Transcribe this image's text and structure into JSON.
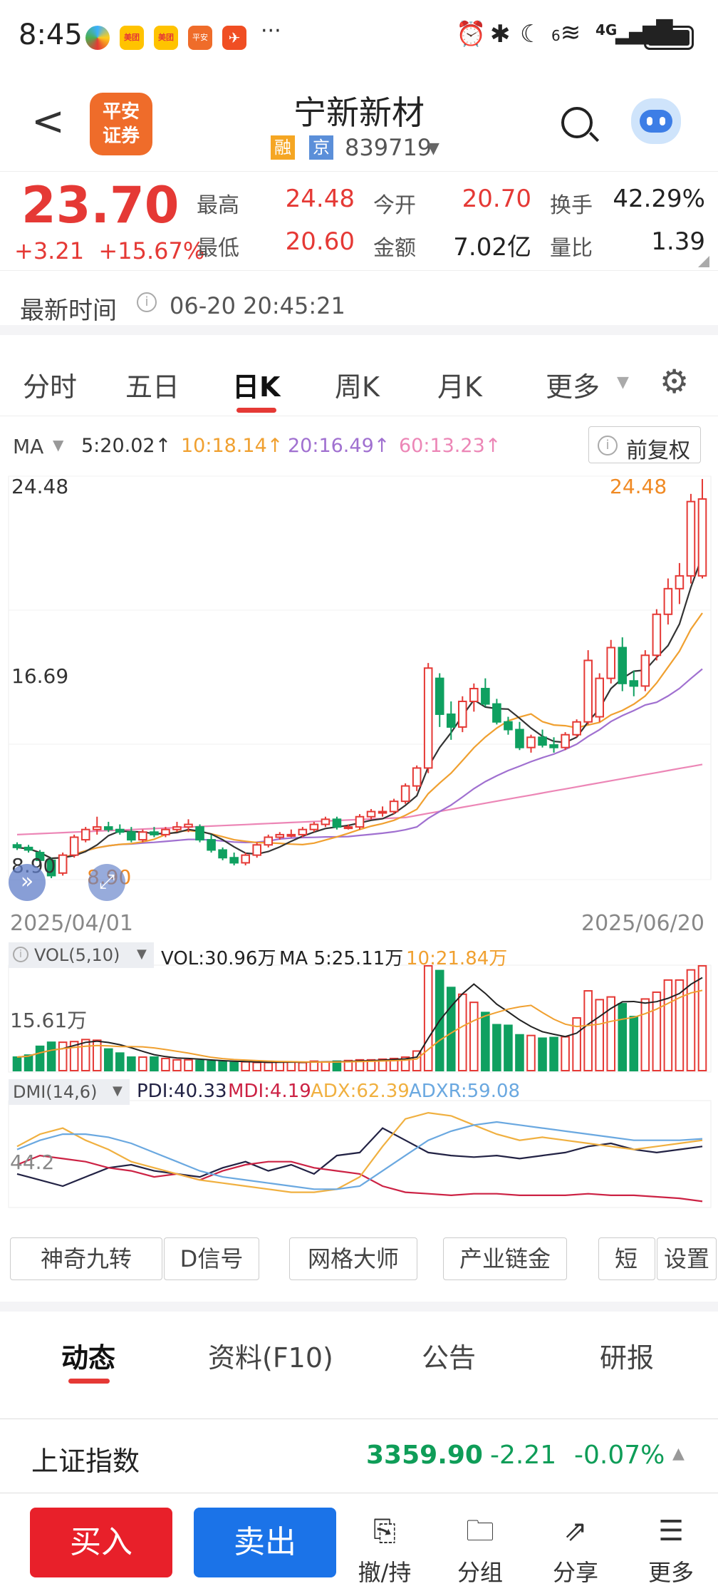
{
  "status_bar": {
    "time": "8:45",
    "network": "4G",
    "signal_superscript": "6"
  },
  "header": {
    "back": "<",
    "broker_logo_lines": [
      "平安",
      "证券"
    ],
    "stock_name": "宁新新材",
    "tag_margin": "融",
    "tag_market": "京",
    "stock_code": "839719"
  },
  "quote": {
    "price": "23.70",
    "change": "+3.21",
    "change_pct": "+15.67%",
    "high_label": "最高",
    "high": "24.48",
    "low_label": "最低",
    "low": "20.60",
    "open_label": "今开",
    "open": "20.70",
    "amount_label": "金额",
    "amount": "7.02亿",
    "turnover_label": "换手",
    "turnover": "42.29%",
    "volume_ratio_label": "量比",
    "volume_ratio": "1.39"
  },
  "update": {
    "label": "最新时间",
    "value": "06-20 20:45:21"
  },
  "chart_tabs": [
    "分时",
    "五日",
    "日K",
    "周K",
    "月K",
    "更多"
  ],
  "chart_tab_active": "日K",
  "ma_line": {
    "label": "MA",
    "ma5": "5:20.02↑",
    "ma10": "10:18.14↑",
    "ma20": "20:16.49↑",
    "ma60": "60:13.23↑",
    "adjust_btn": "前复权",
    "colors": {
      "ma5": "#333333",
      "ma10": "#f0a030",
      "ma20": "#a070d0",
      "ma60": "#ec86b6",
      "up": "#e53935",
      "down": "#0fa060"
    }
  },
  "kline": {
    "y_labels": [
      "24.48",
      "16.69",
      "8.90"
    ],
    "max_label": "24.48",
    "min_label": "8.90",
    "date_start": "2025/04/01",
    "date_end": "2025/06/20"
  },
  "volume": {
    "label": "VOL(5,10)",
    "vol": "VOL:30.96万",
    "ma5": "MA 5:25.11万",
    "ma10": "10:21.84万",
    "y_label": "15.61万"
  },
  "dmi": {
    "label": "DMI(14,6)",
    "pdi": "PDI:40.33",
    "mdi": "MDI:4.19",
    "adx": "ADX:62.39",
    "adxr": "ADXR:59.08",
    "y_label": "44.2",
    "colors": {
      "pdi": "#222244",
      "mdi": "#cc2244",
      "adx": "#f0b040",
      "adxr": "#6aa8e0"
    }
  },
  "feature_buttons": [
    "神奇九转",
    "D信号",
    "网格大师",
    "产业链金",
    "短线",
    "设置"
  ],
  "info_tabs": [
    "动态",
    "资料(F10)",
    "公告",
    "研报"
  ],
  "info_tab_active": "动态",
  "index": {
    "name": "上证指数",
    "value": "3359.90",
    "change": "-2.21",
    "change_pct": "-0.07%"
  },
  "bottom": {
    "buy": "买入",
    "sell": "卖出",
    "icons": [
      {
        "icon": "cancel-hold-icon",
        "label": "撤/持"
      },
      {
        "icon": "group-icon",
        "label": "分组"
      },
      {
        "icon": "share-icon",
        "label": "分享"
      },
      {
        "icon": "more-icon",
        "label": "更多"
      }
    ]
  },
  "chart_data": {
    "type": "candlestick",
    "title": "",
    "x_range": [
      "2025/04/01",
      "2025/06/20"
    ],
    "ylim": [
      8.9,
      24.48
    ],
    "candles_ohlc": [
      [
        10.2,
        10.3,
        10.0,
        10.1
      ],
      [
        10.1,
        10.2,
        9.9,
        10.0
      ],
      [
        9.9,
        10.0,
        9.5,
        9.6
      ],
      [
        9.6,
        9.7,
        8.9,
        9.0
      ],
      [
        9.1,
        9.9,
        9.0,
        9.8
      ],
      [
        9.8,
        10.6,
        9.7,
        10.5
      ],
      [
        10.4,
        10.9,
        10.3,
        10.8
      ],
      [
        10.8,
        11.3,
        10.6,
        10.9
      ],
      [
        10.9,
        11.1,
        10.7,
        10.8
      ],
      [
        10.8,
        11.0,
        10.6,
        10.7
      ],
      [
        10.7,
        10.9,
        10.3,
        10.4
      ],
      [
        10.4,
        10.8,
        10.3,
        10.7
      ],
      [
        10.7,
        10.9,
        10.5,
        10.6
      ],
      [
        10.6,
        10.9,
        10.5,
        10.8
      ],
      [
        10.8,
        11.1,
        10.7,
        10.9
      ],
      [
        10.9,
        11.2,
        10.7,
        11.0
      ],
      [
        10.9,
        11.0,
        10.3,
        10.4
      ],
      [
        10.4,
        10.6,
        9.9,
        10.0
      ],
      [
        10.0,
        10.1,
        9.6,
        9.7
      ],
      [
        9.7,
        9.9,
        9.4,
        9.5
      ],
      [
        9.5,
        9.9,
        9.4,
        9.8
      ],
      [
        9.8,
        10.3,
        9.7,
        10.2
      ],
      [
        10.2,
        10.6,
        10.1,
        10.5
      ],
      [
        10.5,
        10.7,
        10.4,
        10.6
      ],
      [
        10.6,
        10.8,
        10.5,
        10.6
      ],
      [
        10.6,
        10.9,
        10.5,
        10.8
      ],
      [
        10.8,
        11.1,
        10.7,
        11.0
      ],
      [
        11.0,
        11.3,
        10.9,
        11.2
      ],
      [
        11.2,
        11.3,
        10.8,
        10.9
      ],
      [
        10.9,
        11.0,
        10.8,
        10.9
      ],
      [
        10.9,
        11.4,
        10.8,
        11.3
      ],
      [
        11.3,
        11.6,
        11.2,
        11.5
      ],
      [
        11.5,
        11.7,
        11.3,
        11.5
      ],
      [
        11.5,
        12.0,
        11.4,
        11.9
      ],
      [
        11.9,
        12.6,
        11.8,
        12.5
      ],
      [
        12.5,
        13.3,
        12.3,
        13.2
      ],
      [
        13.2,
        17.3,
        13.0,
        17.1
      ],
      [
        16.7,
        16.9,
        14.8,
        15.3
      ],
      [
        15.3,
        15.8,
        14.3,
        14.8
      ],
      [
        14.8,
        16.0,
        14.6,
        15.8
      ],
      [
        15.8,
        16.5,
        15.4,
        16.3
      ],
      [
        16.3,
        16.7,
        15.6,
        15.7
      ],
      [
        15.7,
        15.9,
        14.9,
        15.0
      ],
      [
        15.0,
        15.2,
        14.5,
        14.7
      ],
      [
        14.7,
        15.0,
        13.9,
        14.0
      ],
      [
        14.0,
        14.5,
        13.8,
        14.4
      ],
      [
        14.4,
        14.7,
        14.0,
        14.1
      ],
      [
        14.1,
        14.4,
        13.8,
        14.0
      ],
      [
        14.0,
        14.6,
        13.9,
        14.5
      ],
      [
        14.5,
        15.1,
        14.4,
        15.0
      ],
      [
        15.0,
        17.8,
        14.9,
        17.4
      ],
      [
        15.2,
        16.9,
        15.0,
        16.7
      ],
      [
        16.7,
        18.2,
        16.5,
        17.9
      ],
      [
        17.9,
        18.3,
        16.2,
        16.5
      ],
      [
        16.6,
        17.0,
        16.0,
        16.4
      ],
      [
        16.4,
        17.8,
        16.2,
        17.6
      ],
      [
        17.6,
        19.4,
        17.4,
        19.2
      ],
      [
        19.2,
        20.6,
        18.8,
        20.2
      ],
      [
        20.2,
        21.2,
        19.6,
        20.7
      ],
      [
        20.7,
        23.9,
        20.4,
        23.6
      ],
      [
        20.7,
        24.48,
        20.6,
        23.7
      ]
    ],
    "volume_wan": [
      2,
      2.3,
      3.6,
      4.2,
      4.2,
      4.3,
      4.6,
      4.5,
      3.2,
      2.6,
      2.0,
      2.0,
      2.0,
      1.8,
      1.6,
      1.6,
      1.5,
      1.4,
      1.3,
      1.2,
      1.3,
      1.2,
      1.2,
      1.3,
      1.3,
      1.2,
      1.4,
      1.3,
      1.4,
      1.5,
      1.6,
      1.6,
      1.7,
      1.8,
      2.0,
      2.9,
      15.5,
      14.8,
      12.3,
      11.3,
      10.1,
      8.6,
      6.8,
      6.7,
      5.3,
      5.2,
      4.8,
      4.9,
      5.0,
      7.8,
      11.8,
      10.5,
      10.9,
      9.9,
      8.0,
      10.6,
      11.6,
      13.4,
      13.4,
      14.9,
      15.5
    ]
  }
}
